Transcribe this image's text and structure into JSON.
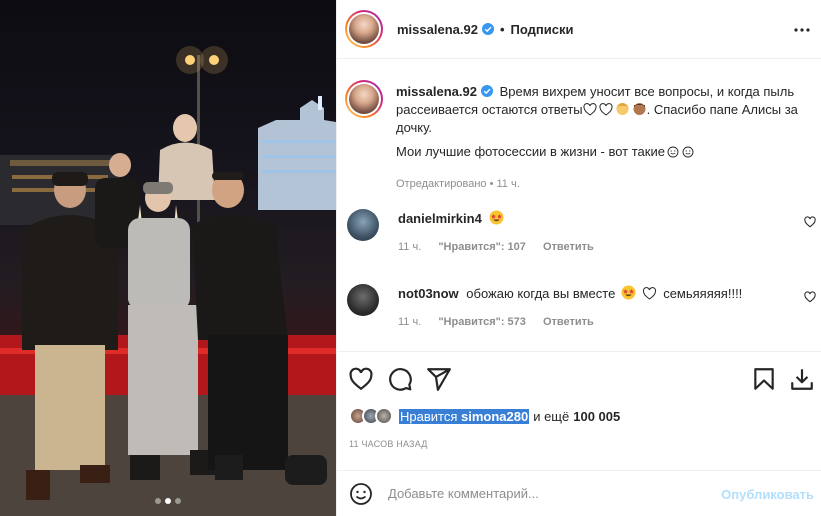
{
  "post": {
    "username": "missalena.92",
    "follow_label": "Подписки",
    "separator": "•",
    "caption_line1": "Время вихрем уносит все вопросы, и когда пыль рассеивается остаются ответы",
    "caption_line2": ". Спасибо папе Алисы за дочку.",
    "caption_line3": "Мои лучшие фотосессии в жизни - вот такие",
    "edited_label": "Отредактировано",
    "edited_time": "11 ч."
  },
  "comments": [
    {
      "username": "danielmirkin4",
      "text": "",
      "time": "11 ч.",
      "likes": "\"Нравится\": 107",
      "reply": "Ответить"
    },
    {
      "username": "not03now",
      "text": "обожаю когда вы вместе",
      "text_end": "семьяяяяя!!!!",
      "time": "11 ч.",
      "likes": "\"Нравится\": 573",
      "reply": "Ответить"
    }
  ],
  "likes": {
    "prefix": "Нравится",
    "user": "simona280",
    "suffix": "и ещё",
    "count": "100 005"
  },
  "time_ago": "11 ЧАСОВ НАЗАД",
  "add_comment": {
    "placeholder": "Добавьте комментарий...",
    "publish": "Опубликовать"
  },
  "icons": {
    "header": [
      "verified-badge-icon",
      "more-options-icon"
    ],
    "actions": [
      "like-icon",
      "comment-icon",
      "share-icon",
      "bookmark-icon",
      "download-icon"
    ],
    "comment": [
      "heart-icon",
      "smile-icon"
    ]
  },
  "colors": {
    "verified": "#3897f0",
    "link_disabled": "#b2dffc",
    "selection": "#3a7fd6",
    "muted": "#8e8e8e"
  },
  "carousel": {
    "count": 3,
    "active": 2
  }
}
